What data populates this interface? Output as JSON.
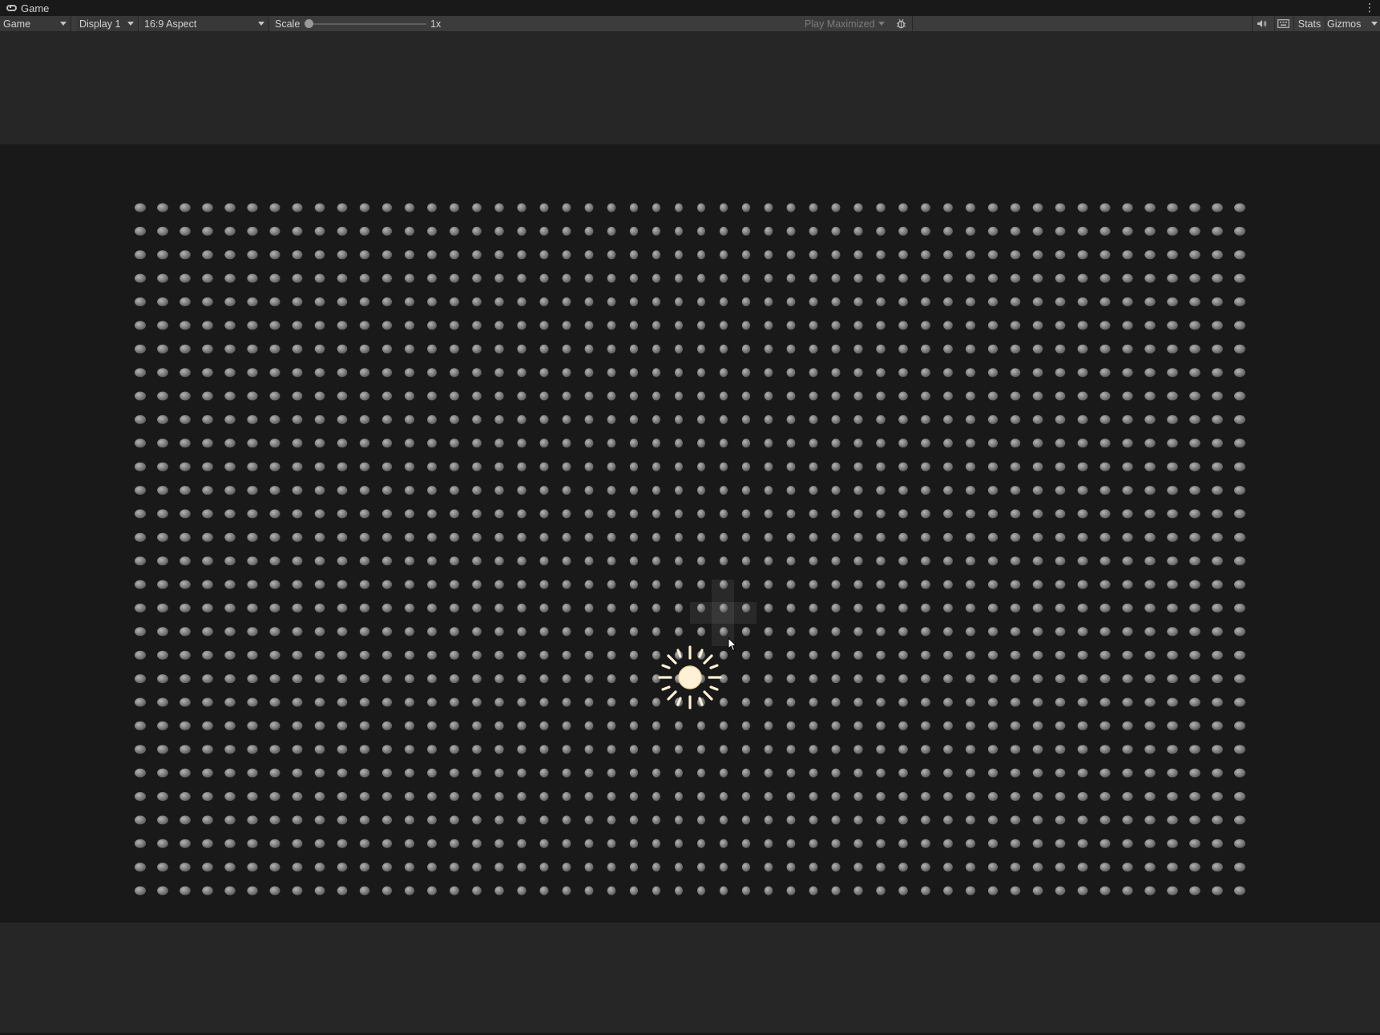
{
  "window": {
    "tab_title": "Game",
    "tab_icon": "gamepad-icon",
    "more_icon": "vertical-ellipsis-icon",
    "more_glyph": "⋮"
  },
  "toolbar": {
    "view_dropdown": "Game",
    "display_dropdown": "Display 1",
    "aspect_dropdown": "16:9 Aspect",
    "scale_label": "Scale",
    "scale_value_label": "1x",
    "scale_level": 0.0,
    "play_mode_dropdown": "Play Maximized",
    "debug_icon": "bug-icon",
    "mute_icon": "speaker-icon",
    "keyboard_icon": "keyboard-icon",
    "stats_button": "Stats",
    "gizmos_button": "Gizmos"
  },
  "scene": {
    "grid_columns": 50,
    "grid_rows": 30,
    "dot_color": "#8c8c8c",
    "dot_highlight_color": "#b4b4b4",
    "background_color": "#191919",
    "letterbox_color": "#262626",
    "light_icon": "sun-icon",
    "light_color": "#fff1d6",
    "cursor_icon": "mouse-pointer-icon"
  }
}
